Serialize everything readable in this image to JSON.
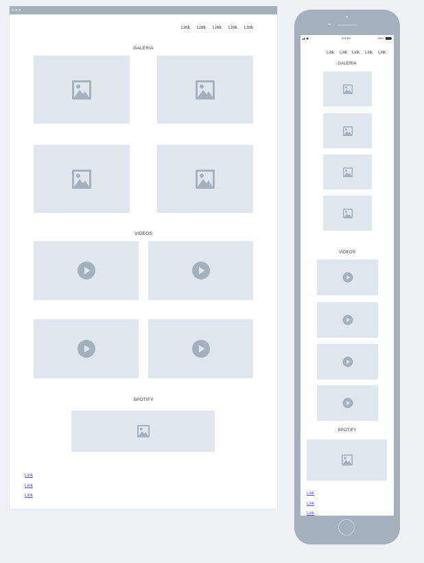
{
  "desktop": {
    "nav_links": [
      "Link",
      "Link",
      "Link",
      "Link",
      "Link"
    ],
    "galeria_title": "GALERIA",
    "videos_title": "VIDEOS",
    "spotify_title": "SPOTIFY",
    "footer_links": [
      "Link",
      "Link",
      "Link"
    ]
  },
  "mobile": {
    "status_time": "3:10 PM",
    "status_battery": "100%",
    "nav_links": [
      "Link",
      "Link",
      "Link",
      "Link",
      "Link"
    ],
    "galeria_title": "GALERIA",
    "videos_title": "VIDEOS",
    "spotify_title": "SPOTIFY",
    "footer_links": [
      "Link",
      "Link",
      "Link"
    ]
  },
  "colors": {
    "page_background": "#eef2f6",
    "chrome": "#a4b0bb",
    "placeholder": "#dfe6ee",
    "icon": "#a4b0bb",
    "link": "#4a4adf"
  },
  "icons": {
    "image_placeholder": "image-icon",
    "video_placeholder": "play-icon"
  }
}
